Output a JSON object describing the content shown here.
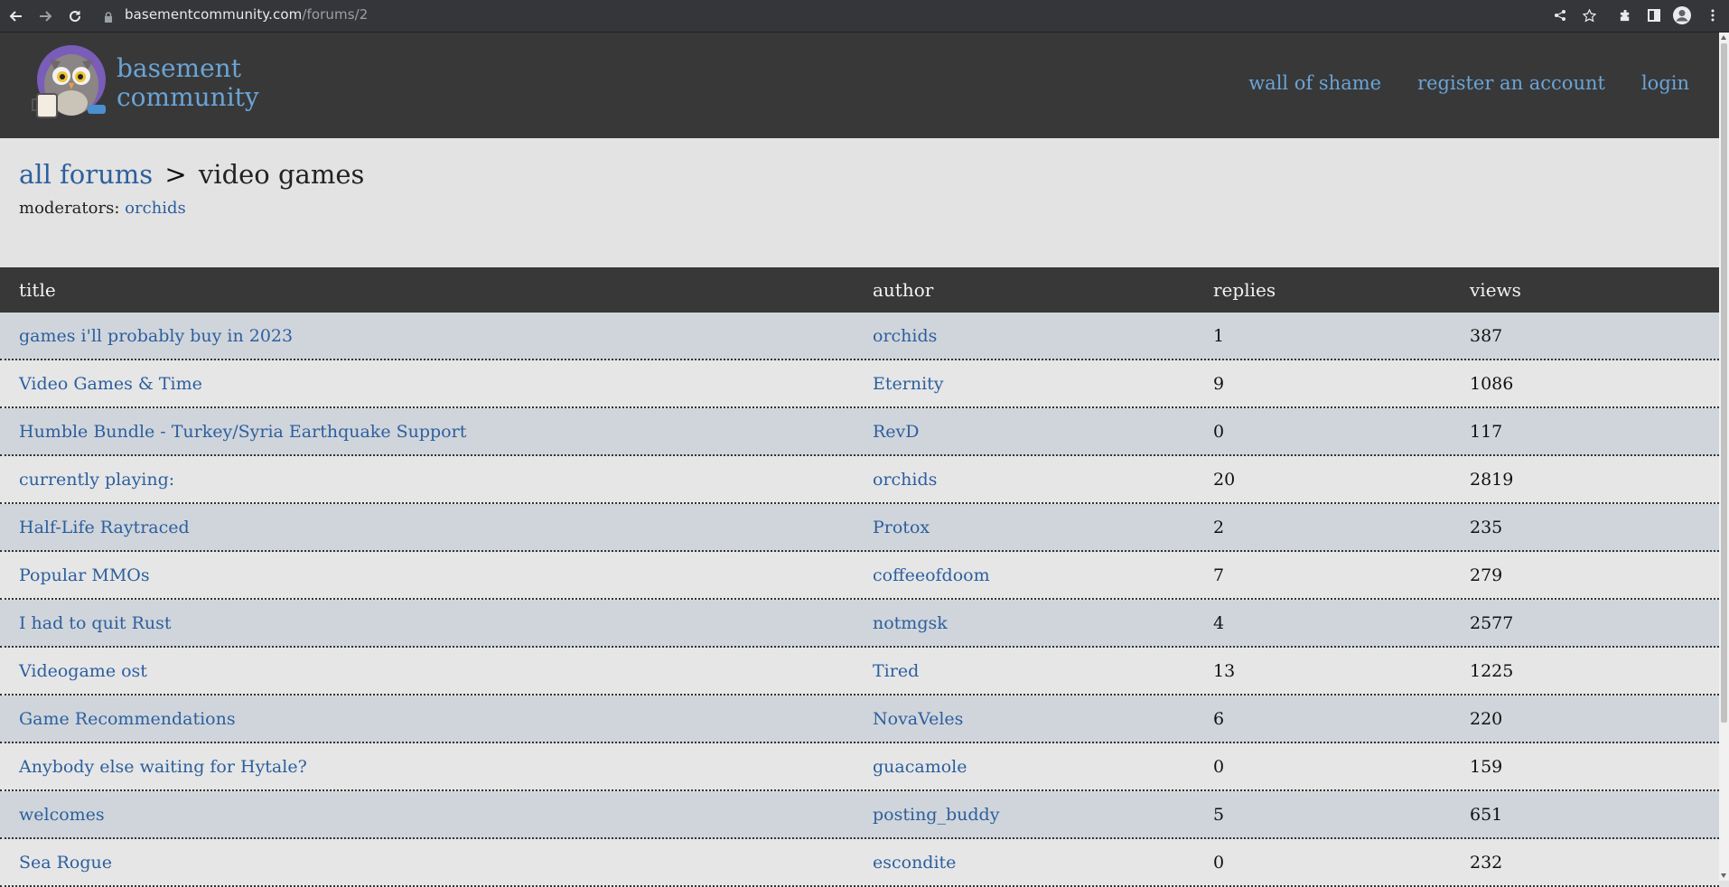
{
  "browser": {
    "url_domain": "basementcommunity.com",
    "url_path": "/forums/2",
    "icons": [
      "back-icon",
      "forward-icon",
      "reload-icon",
      "lock-icon",
      "share-icon",
      "star-icon",
      "extensions-icon",
      "sidepanel-icon",
      "profile-icon",
      "menu-icon"
    ]
  },
  "header": {
    "brand_line1": "basement",
    "brand_line2": "community",
    "nav": [
      "wall of shame",
      "register an account",
      "login"
    ],
    "colors": {
      "bg": "#383838",
      "link": "#6aa4d6"
    }
  },
  "breadcrumb": {
    "root": "all forums",
    "separator": ">",
    "current": "video games"
  },
  "moderators": {
    "label": "moderators:",
    "name": "orchids"
  },
  "table": {
    "headers": [
      "title",
      "author",
      "replies",
      "views"
    ],
    "rows": [
      {
        "title": "games i'll probably buy in 2023",
        "author": "orchids",
        "replies": "1",
        "views": "387"
      },
      {
        "title": "Video Games & Time",
        "author": "Eternity",
        "replies": "9",
        "views": "1086"
      },
      {
        "title": "Humble Bundle - Turkey/Syria Earthquake Support",
        "author": "RevD",
        "replies": "0",
        "views": "117"
      },
      {
        "title": "currently playing:",
        "author": "orchids",
        "replies": "20",
        "views": "2819"
      },
      {
        "title": "Half-Life Raytraced",
        "author": "Protox",
        "replies": "2",
        "views": "235"
      },
      {
        "title": "Popular MMOs",
        "author": "coffeeofdoom",
        "replies": "7",
        "views": "279"
      },
      {
        "title": "I had to quit Rust",
        "author": "notmgsk",
        "replies": "4",
        "views": "2577"
      },
      {
        "title": "Videogame ost",
        "author": "Tired",
        "replies": "13",
        "views": "1225"
      },
      {
        "title": "Game Recommendations",
        "author": "NovaVeles",
        "replies": "6",
        "views": "220"
      },
      {
        "title": "Anybody else waiting for Hytale?",
        "author": "guacamole",
        "replies": "0",
        "views": "159"
      },
      {
        "title": "welcomes",
        "author": "posting_buddy",
        "replies": "5",
        "views": "651"
      },
      {
        "title": "Sea Rogue",
        "author": "escondite",
        "replies": "0",
        "views": "232"
      }
    ]
  }
}
